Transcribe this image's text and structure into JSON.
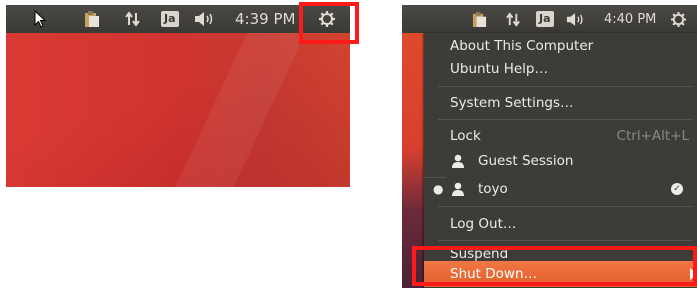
{
  "left_panel": {
    "clock": "4:39 PM",
    "input_method": "Ja",
    "icons": [
      "cursor-arrow",
      "clipboard-icon",
      "network-arrows-icon",
      "volume-icon",
      "gear-icon"
    ]
  },
  "right_panel": {
    "clock": "4:40 PM",
    "input_method": "Ja"
  },
  "menu": {
    "about": "About This Computer",
    "help": "Ubuntu Help…",
    "settings": "System Settings…",
    "lock": "Lock",
    "lock_shortcut": "Ctrl+Alt+L",
    "guest": "Guest Session",
    "user": "toyo",
    "logout": "Log Out…",
    "suspend": "Suspend",
    "shutdown": "Shut Down…"
  },
  "colors": {
    "highlight": "#ff1a1a",
    "menu_bg": "#3d3c38",
    "selected_item": "#e35f2a"
  }
}
